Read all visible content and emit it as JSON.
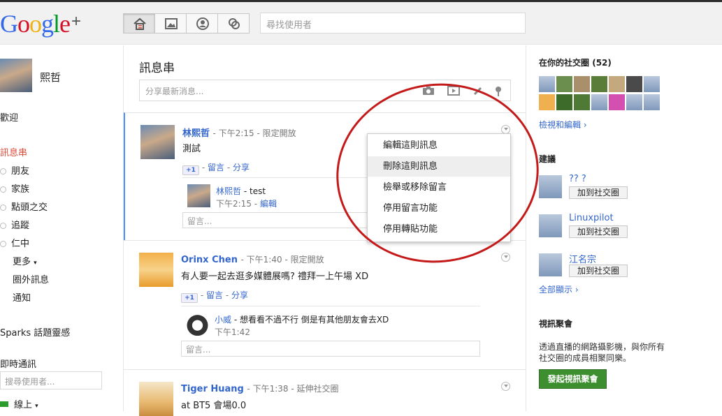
{
  "topbar": {
    "logo_text": "Google",
    "logo_plus": "+",
    "search_placeholder": "尋找使用者"
  },
  "sidebar": {
    "profile_name": "熙哲",
    "welcome": "歡迎",
    "stream": "訊息串",
    "circles": [
      "朋友",
      "家族",
      "點頭之交",
      "追蹤",
      "仁中"
    ],
    "more": "更多",
    "more_arrow": "▾",
    "incoming": "圈外訊息",
    "notifications": "通知",
    "sparks": "Sparks 話題靈感",
    "chat_title": "即時通訊",
    "chat_placeholder": "搜尋使用者...",
    "online": "線上",
    "online_arrow": "▾"
  },
  "main": {
    "title": "訊息串",
    "share_placeholder": "分享最新消息...",
    "posts": [
      {
        "author": "林熙哲",
        "time": "下午2:15",
        "visibility": "限定開放",
        "text": "測試",
        "plus1": "+1",
        "comment_link": "留言",
        "share_link": "分享",
        "comment": {
          "author": "林熙哲",
          "text": "test",
          "time": "下午2:15",
          "edit": "編輯"
        },
        "comment_placeholder": "留言..."
      },
      {
        "author": "Orinx Chen",
        "time": "下午1:40",
        "visibility": "限定開放",
        "text": "有人要一起去逛多媒體展嗎? 禮拜一上午場 XD",
        "plus1": "+1",
        "comment_link": "留言",
        "share_link": "分享",
        "comment": {
          "author": "小威",
          "text": "想看看不過不行 倒是有其他朋友會去XD",
          "time": "下午1:42"
        },
        "comment_placeholder": "留言..."
      },
      {
        "author": "Tiger Huang",
        "time": "下午1:38",
        "visibility": "延伸社交圈",
        "text": "at BT5 會場0.0"
      }
    ],
    "separator": "-"
  },
  "menu": {
    "items": [
      "編輯這則訊息",
      "刪除這則訊息",
      "檢舉或移除留言",
      "停用留言功能",
      "停用轉貼功能"
    ]
  },
  "right": {
    "circles_title": "在你的社交圈",
    "circles_count": "(52)",
    "view_edit": "檢視和編輯 ›",
    "suggest_title": "建議",
    "suggestions": [
      {
        "name": "?? ?",
        "button": "加到社交圈"
      },
      {
        "name": "Linuxpilot",
        "button": "加到社交圈"
      },
      {
        "name": "江名宗",
        "button": "加到社交圈"
      }
    ],
    "show_all": "全部顯示 ›",
    "hangout_title": "視訊聚會",
    "hangout_desc": "透過直播的網路攝影機，與你所有社交圈的成員相聚同樂。",
    "hangout_button": "發起視訊聚會"
  },
  "colors": {
    "accent_blue": "#3366cc",
    "stream_red": "#dd4b39",
    "hangout_green": "#3c8e2e",
    "annotation_red": "#c41a1a"
  }
}
